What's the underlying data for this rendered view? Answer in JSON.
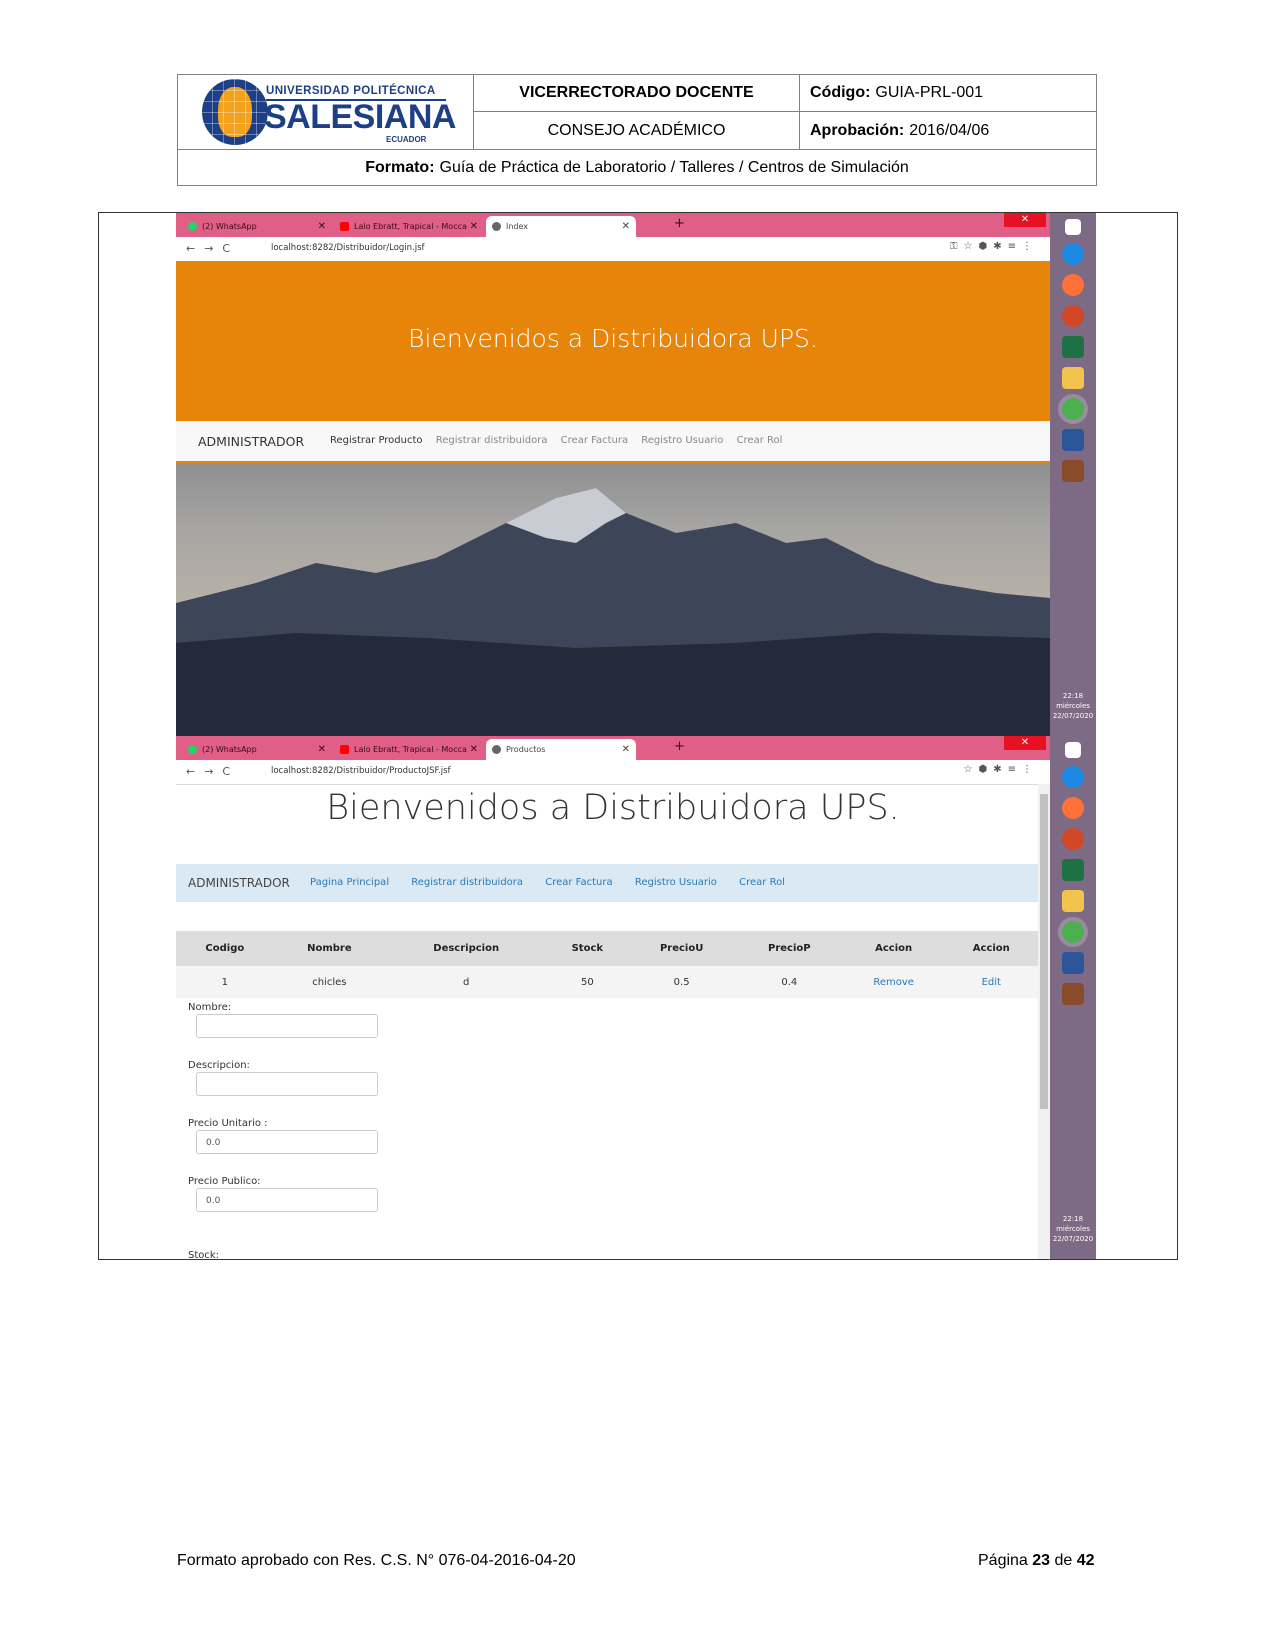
{
  "doc_header": {
    "logo_line1": "UNIVERSIDAD POLITÉCNICA",
    "logo_line2": "SALESIANA",
    "logo_line3": "ECUADOR",
    "vicerrectorado": "VICERRECTORADO DOCENTE",
    "codigo_label": "Código:",
    "codigo_value": "GUIA-PRL-001",
    "consejo": "CONSEJO ACADÉMICO",
    "aprobacion_label": "Aprobación:",
    "aprobacion_value": "2016/04/06",
    "formato_label": "Formato:",
    "formato_value": "Guía de Práctica de Laboratorio / Talleres / Centros de Simulación"
  },
  "browser_tabs": [
    {
      "label": "(2) WhatsApp",
      "icon": "whatsapp-icon"
    },
    {
      "label": "Lalo Ebratt, Trapical - Mocca",
      "icon": "youtube-icon"
    },
    {
      "label": "Index",
      "icon": "globe-icon"
    }
  ],
  "browser_tabs2": [
    {
      "label": "(2) WhatsApp",
      "icon": "whatsapp-icon"
    },
    {
      "label": "Lalo Ebratt, Trapical - Mocca",
      "icon": "youtube-icon"
    },
    {
      "label": "Productos",
      "icon": "globe-icon"
    }
  ],
  "screen1": {
    "url": "localhost:8282/Distribuidor/Login.jsf",
    "banner_title": "Bienvenidos a Distribuidora UPS.",
    "brand": "ADMINISTRADOR",
    "nav": [
      "Registrar Producto",
      "Registrar distribuidora",
      "Crear Factura",
      "Registro Usuario",
      "Crear Rol"
    ]
  },
  "screen2": {
    "url": "localhost:8282/Distribuidor/ProductoJSF.jsf",
    "title": "Bienvenidos a Distribuidora UPS.",
    "brand": "ADMINISTRADOR",
    "nav": [
      "Pagina Principal",
      "Registrar distribuidora",
      "Crear Factura",
      "Registro Usuario",
      "Crear Rol"
    ],
    "table_headers": [
      "Codigo",
      "Nombre",
      "Descripcion",
      "Stock",
      "PrecioU",
      "PrecioP",
      "Accion",
      "Accion"
    ],
    "table_rows": [
      {
        "codigo": "1",
        "nombre": "chicles",
        "descripcion": "d",
        "stock": "50",
        "preciou": "0.5",
        "preciop": "0.4",
        "remove": "Remove",
        "edit": "Edit"
      }
    ],
    "form": {
      "nombre_label": "Nombre:",
      "descripcion_label": "Descripcion:",
      "precio_unitario_label": "Precio Unitario :",
      "precio_unitario_value": "0.0",
      "precio_publico_label": "Precio Publico:",
      "precio_publico_value": "0.0",
      "stock_label": "Stock:"
    }
  },
  "taskbar": {
    "time": "22:18",
    "day": "miércoles",
    "date": "22/07/2020"
  },
  "footer": {
    "left": "Formato aprobado con Res. C.S. N° 076-04-2016-04-20",
    "page_label": "Página",
    "page": "23",
    "of_label": "de",
    "total": "42"
  },
  "colors": {
    "banner": "#e6850a",
    "tabbar": "#e05f87",
    "taskbar": "#7d6a84",
    "link": "#2a7ab8",
    "brand_blue": "#1d3f86"
  }
}
